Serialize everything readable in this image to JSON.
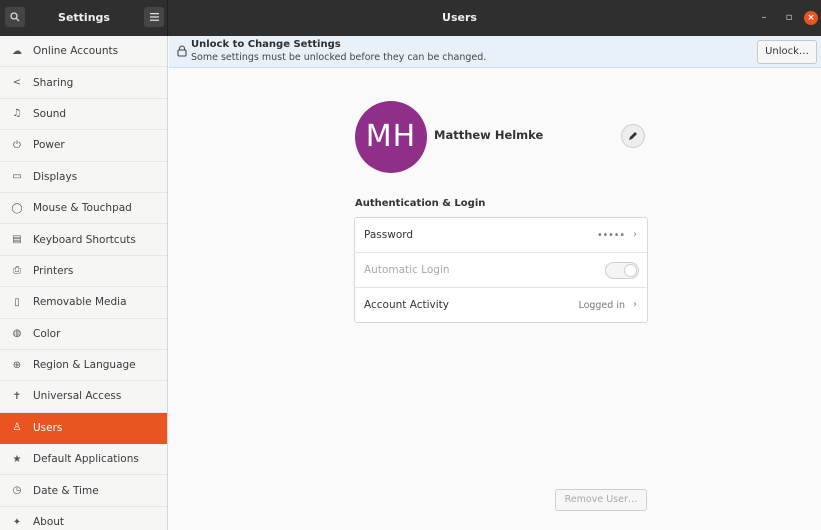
{
  "header": {
    "left_title": "Settings",
    "main_title": "Users",
    "icons": {
      "search": "search-icon",
      "menu": "hamburger-menu-icon"
    },
    "window_controls": {
      "minimize": "–",
      "maximize": "▫",
      "close": "×"
    }
  },
  "sidebar": {
    "items": [
      {
        "icon": "cloud-icon",
        "glyph": "☁",
        "label": "Online Accounts"
      },
      {
        "icon": "share-icon",
        "glyph": "<",
        "label": "Sharing"
      },
      {
        "icon": "music-note-icon",
        "glyph": "♫",
        "label": "Sound"
      },
      {
        "icon": "power-icon",
        "glyph": "⏻",
        "label": "Power"
      },
      {
        "icon": "display-icon",
        "glyph": "▭",
        "label": "Displays"
      },
      {
        "icon": "mouse-icon",
        "glyph": "◯",
        "label": "Mouse & Touchpad"
      },
      {
        "icon": "keyboard-icon",
        "glyph": "▤",
        "label": "Keyboard Shortcuts"
      },
      {
        "icon": "printer-icon",
        "glyph": "⎙",
        "label": "Printers"
      },
      {
        "icon": "removable-media-icon",
        "glyph": "▯",
        "label": "Removable Media"
      },
      {
        "icon": "color-icon",
        "glyph": "◍",
        "label": "Color"
      },
      {
        "icon": "globe-icon",
        "glyph": "⊕",
        "label": "Region & Language"
      },
      {
        "icon": "accessibility-icon",
        "glyph": "✝",
        "label": "Universal Access"
      },
      {
        "icon": "user-icon",
        "glyph": "♙",
        "label": "Users",
        "active": true
      },
      {
        "icon": "star-icon",
        "glyph": "★",
        "label": "Default Applications"
      },
      {
        "icon": "clock-icon",
        "glyph": "◷",
        "label": "Date & Time"
      },
      {
        "icon": "about-icon",
        "glyph": "✦",
        "label": "About"
      }
    ]
  },
  "infobar": {
    "title": "Unlock to Change Settings",
    "subtitle": "Some settings must be unlocked before they can be changed.",
    "unlock_label": "Unlock…",
    "lock_icon": "lock-icon"
  },
  "user": {
    "initials": "MH",
    "name": "Matthew Helmke",
    "avatar_color": "#8f2f8a"
  },
  "auth": {
    "section_title": "Authentication & Login",
    "rows": [
      {
        "label": "Password",
        "value": "•••••",
        "type": "link"
      },
      {
        "label": "Automatic Login",
        "type": "toggle",
        "enabled": false,
        "dimmed": true
      },
      {
        "label": "Account Activity",
        "value": "Logged in",
        "type": "link"
      }
    ]
  },
  "remove_user_label": "Remove User…",
  "colors": {
    "accent": "#e95420",
    "headerbar": "#2f2f2f",
    "infobar": "#e9f1f8"
  }
}
